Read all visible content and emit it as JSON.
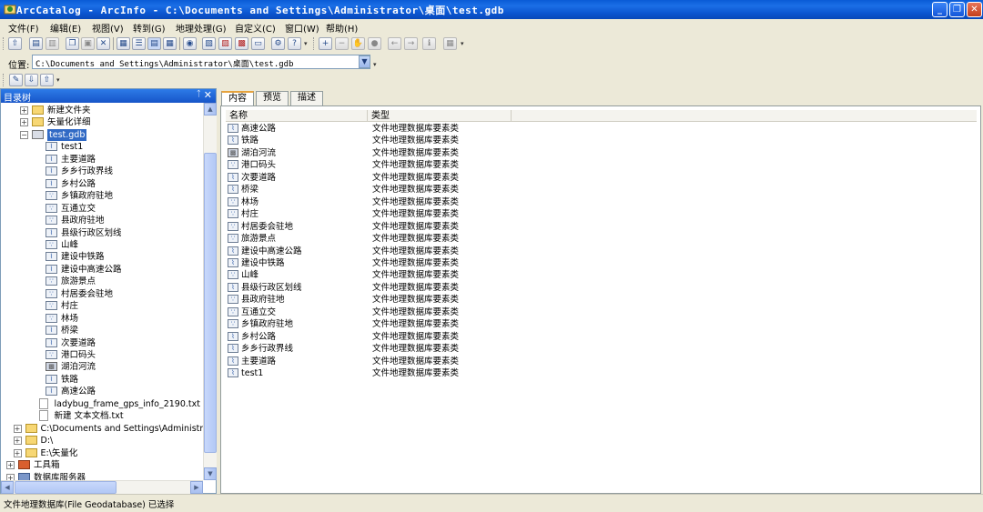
{
  "window": {
    "title": "ArcCatalog - ArcInfo - C:\\Documents and Settings\\Administrator\\桌面\\test.gdb",
    "minimize": "_",
    "maximize": "❐",
    "close": "✕"
  },
  "menu": [
    {
      "label": "文件(F)"
    },
    {
      "label": "编辑(E)"
    },
    {
      "label": "视图(V)"
    },
    {
      "label": "转到(G)"
    },
    {
      "label": "地理处理(G)"
    },
    {
      "label": "自定义(C)"
    },
    {
      "label": "窗口(W)"
    },
    {
      "label": "帮助(H)"
    }
  ],
  "toolbar": {
    "icons": [
      {
        "name": "up-one-level-icon",
        "glyph": "⇧"
      },
      {
        "name": "connect-folder-icon",
        "glyph": "▤"
      },
      {
        "name": "disconnect-folder-icon",
        "glyph": "▥"
      },
      {
        "name": "copy-icon",
        "glyph": "❐"
      },
      {
        "name": "paste-icon",
        "glyph": "▣"
      },
      {
        "name": "delete-icon",
        "glyph": "✕"
      },
      {
        "name": "large-icons-icon",
        "glyph": "▦"
      },
      {
        "name": "list-view-icon",
        "glyph": "☰"
      },
      {
        "name": "details-view-icon",
        "glyph": "▤"
      },
      {
        "name": "thumbnails-icon",
        "glyph": "▦"
      },
      {
        "name": "search-icon",
        "glyph": "◉"
      },
      {
        "name": "toolbox-icon",
        "glyph": "▧"
      },
      {
        "name": "arctoolbox-icon",
        "glyph": "▨"
      },
      {
        "name": "python-window-icon",
        "glyph": "▩"
      },
      {
        "name": "command-line-icon",
        "glyph": "▭"
      },
      {
        "name": "model-builder-icon",
        "glyph": "⚙"
      },
      {
        "name": "whats-this-icon",
        "glyph": "?"
      }
    ],
    "geography_icons": [
      {
        "name": "zoom-in-icon",
        "glyph": "+"
      },
      {
        "name": "zoom-out-icon",
        "glyph": "−"
      },
      {
        "name": "pan-icon",
        "glyph": "✋"
      },
      {
        "name": "full-extent-icon",
        "glyph": "●"
      },
      {
        "name": "back-icon",
        "glyph": "←"
      },
      {
        "name": "forward-icon",
        "glyph": "→"
      },
      {
        "name": "identify-icon",
        "glyph": "ℹ"
      },
      {
        "name": "generate-thumbnail-icon",
        "glyph": "▦"
      }
    ],
    "metadata_icons": [
      {
        "name": "edit-metadata-icon",
        "glyph": "✎"
      },
      {
        "name": "import-metadata-icon",
        "glyph": "⇩"
      },
      {
        "name": "export-metadata-icon",
        "glyph": "⇧"
      }
    ]
  },
  "location": {
    "label": "位置:",
    "value": "C:\\Documents and Settings\\Administrator\\桌面\\test.gdb"
  },
  "catalog_tree": {
    "title": "目录树",
    "pin": "ᛏ",
    "close": "✕",
    "rows": [
      {
        "indent": 1,
        "exp": "+",
        "icon": "folder",
        "glyph": "",
        "label": "新建文件夹"
      },
      {
        "indent": 1,
        "exp": "+",
        "icon": "folder",
        "glyph": "",
        "label": "矢量化详细"
      },
      {
        "indent": 1,
        "exp": "−",
        "icon": "gdb",
        "glyph": "",
        "label": "test.gdb",
        "selected": true
      },
      {
        "indent": 2,
        "icon": "line",
        "glyph": "⌇",
        "label": "test1"
      },
      {
        "indent": 2,
        "icon": "line",
        "glyph": "⌇",
        "label": "主要道路"
      },
      {
        "indent": 2,
        "icon": "line",
        "glyph": "⌇",
        "label": "乡乡行政界线"
      },
      {
        "indent": 2,
        "icon": "line",
        "glyph": "⌇",
        "label": "乡村公路"
      },
      {
        "indent": 2,
        "icon": "point",
        "glyph": "∵",
        "label": "乡镇政府驻地"
      },
      {
        "indent": 2,
        "icon": "point",
        "glyph": "∵",
        "label": "互通立交"
      },
      {
        "indent": 2,
        "icon": "point",
        "glyph": "∵",
        "label": "县政府驻地"
      },
      {
        "indent": 2,
        "icon": "line",
        "glyph": "⌇",
        "label": "县级行政区划线"
      },
      {
        "indent": 2,
        "icon": "point",
        "glyph": "∵",
        "label": "山峰"
      },
      {
        "indent": 2,
        "icon": "line",
        "glyph": "⌇",
        "label": "建设中铁路"
      },
      {
        "indent": 2,
        "icon": "line",
        "glyph": "⌇",
        "label": "建设中高速公路"
      },
      {
        "indent": 2,
        "icon": "point",
        "glyph": "∵",
        "label": "旅游景点"
      },
      {
        "indent": 2,
        "icon": "point",
        "glyph": "∵",
        "label": "村居委会驻地"
      },
      {
        "indent": 2,
        "icon": "point",
        "glyph": "∵",
        "label": "村庄"
      },
      {
        "indent": 2,
        "icon": "point",
        "glyph": "∵",
        "label": "林场"
      },
      {
        "indent": 2,
        "icon": "line",
        "glyph": "⌇",
        "label": "桥梁"
      },
      {
        "indent": 2,
        "icon": "line",
        "glyph": "⌇",
        "label": "次要道路"
      },
      {
        "indent": 2,
        "icon": "point",
        "glyph": "∵",
        "label": "港口码头"
      },
      {
        "indent": 2,
        "icon": "poly",
        "glyph": "▩",
        "label": "湖泊河流"
      },
      {
        "indent": 2,
        "icon": "line",
        "glyph": "⌇",
        "label": "铁路"
      },
      {
        "indent": 2,
        "icon": "line",
        "glyph": "⌇",
        "label": "高速公路"
      },
      {
        "indent": 1.5,
        "icon": "doc",
        "glyph": "",
        "label": "ladybug_frame_gps_info_2190.txt"
      },
      {
        "indent": 1.5,
        "icon": "doc",
        "glyph": "",
        "label": "新建 文本文档.txt"
      },
      {
        "indent": 0.5,
        "exp": "+",
        "icon": "folder",
        "glyph": "",
        "label": "C:\\Documents and Settings\\Administra"
      },
      {
        "indent": 0.5,
        "exp": "+",
        "icon": "folder",
        "glyph": "",
        "label": "D:\\"
      },
      {
        "indent": 0.5,
        "exp": "+",
        "icon": "folder",
        "glyph": "",
        "label": "E:\\矢量化"
      },
      {
        "indent": 0,
        "exp": "+",
        "icon": "tool",
        "glyph": "",
        "label": "工具箱"
      },
      {
        "indent": 0,
        "exp": "+",
        "icon": "db",
        "glyph": "",
        "label": "数据库服务器"
      }
    ]
  },
  "tabs": [
    {
      "label": "内容",
      "active": true
    },
    {
      "label": "预览",
      "active": false
    },
    {
      "label": "描述",
      "active": false
    }
  ],
  "contents": {
    "columns": [
      "名称",
      "类型"
    ],
    "rows": [
      {
        "icon": "line",
        "glyph": "⌇",
        "name": "高速公路",
        "type": "文件地理数据库要素类"
      },
      {
        "icon": "line",
        "glyph": "⌇",
        "name": "铁路",
        "type": "文件地理数据库要素类"
      },
      {
        "icon": "poly",
        "glyph": "▩",
        "name": "湖泊河流",
        "type": "文件地理数据库要素类"
      },
      {
        "icon": "point",
        "glyph": "∵",
        "name": "港口码头",
        "type": "文件地理数据库要素类"
      },
      {
        "icon": "line",
        "glyph": "⌇",
        "name": "次要道路",
        "type": "文件地理数据库要素类"
      },
      {
        "icon": "line",
        "glyph": "⌇",
        "name": "桥梁",
        "type": "文件地理数据库要素类"
      },
      {
        "icon": "point",
        "glyph": "∵",
        "name": "林场",
        "type": "文件地理数据库要素类"
      },
      {
        "icon": "point",
        "glyph": "∵",
        "name": "村庄",
        "type": "文件地理数据库要素类"
      },
      {
        "icon": "point",
        "glyph": "∵",
        "name": "村居委会驻地",
        "type": "文件地理数据库要素类"
      },
      {
        "icon": "point",
        "glyph": "∵",
        "name": "旅游景点",
        "type": "文件地理数据库要素类"
      },
      {
        "icon": "line",
        "glyph": "⌇",
        "name": "建设中高速公路",
        "type": "文件地理数据库要素类"
      },
      {
        "icon": "line",
        "glyph": "⌇",
        "name": "建设中铁路",
        "type": "文件地理数据库要素类"
      },
      {
        "icon": "point",
        "glyph": "∵",
        "name": "山峰",
        "type": "文件地理数据库要素类"
      },
      {
        "icon": "line",
        "glyph": "⌇",
        "name": "县级行政区划线",
        "type": "文件地理数据库要素类"
      },
      {
        "icon": "point",
        "glyph": "∵",
        "name": "县政府驻地",
        "type": "文件地理数据库要素类"
      },
      {
        "icon": "point",
        "glyph": "∵",
        "name": "互通立交",
        "type": "文件地理数据库要素类"
      },
      {
        "icon": "point",
        "glyph": "∵",
        "name": "乡镇政府驻地",
        "type": "文件地理数据库要素类"
      },
      {
        "icon": "line",
        "glyph": "⌇",
        "name": "乡村公路",
        "type": "文件地理数据库要素类"
      },
      {
        "icon": "line",
        "glyph": "⌇",
        "name": "乡乡行政界线",
        "type": "文件地理数据库要素类"
      },
      {
        "icon": "line",
        "glyph": "⌇",
        "name": "主要道路",
        "type": "文件地理数据库要素类"
      },
      {
        "icon": "line",
        "glyph": "⌇",
        "name": "test1",
        "type": "文件地理数据库要素类"
      }
    ]
  },
  "status": {
    "text": "文件地理数据库(File Geodatabase) 已选择"
  },
  "colors": {
    "title_bar": "#0a5bd6",
    "selection": "#316ac5",
    "tab_accent": "#e6a23c"
  }
}
